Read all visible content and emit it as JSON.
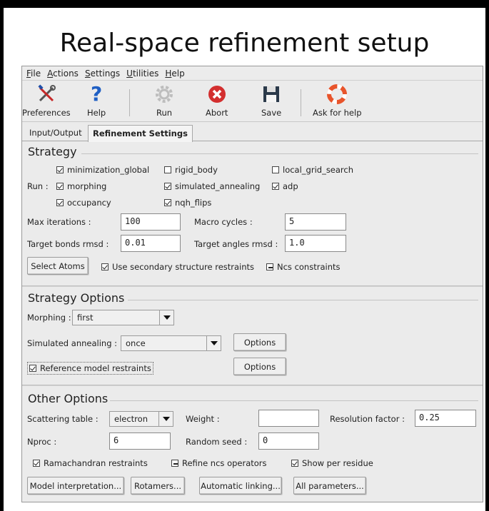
{
  "slide_title": "Real-space refinement setup",
  "menu": [
    {
      "first": "F",
      "rest": "ile"
    },
    {
      "first": "A",
      "rest": "ctions"
    },
    {
      "first": "S",
      "rest": "ettings"
    },
    {
      "first": "U",
      "rest": "tilities"
    },
    {
      "first": "H",
      "rest": "elp"
    }
  ],
  "toolbar": {
    "preferences": "Preferences",
    "help": "Help",
    "run": "Run",
    "abort": "Abort",
    "save": "Save",
    "ask_for_help": "Ask for help"
  },
  "tabs": {
    "input_output": "Input/Output",
    "refinement_settings": "Refinement Settings"
  },
  "strategy": {
    "title": "Strategy",
    "run_label": "Run :",
    "checks": {
      "minimization_global": "minimization_global",
      "rigid_body": "rigid_body",
      "local_grid_search": "local_grid_search",
      "morphing": "morphing",
      "simulated_annealing": "simulated_annealing",
      "adp": "adp",
      "occupancy": "occupancy",
      "nqh_flips": "nqh_flips"
    },
    "max_iterations_label": "Max iterations :",
    "max_iterations": "100",
    "macro_cycles_label": "Macro cycles :",
    "macro_cycles": "5",
    "target_bonds_label": "Target bonds rmsd :",
    "target_bonds": "0.01",
    "target_angles_label": "Target angles rmsd :",
    "target_angles": "1.0",
    "select_atoms": "Select Atoms",
    "secondary_structure": "Use secondary structure restraints",
    "ncs_constraints": "Ncs constraints"
  },
  "strategy_options": {
    "title": "Strategy Options",
    "morphing_label": "Morphing :",
    "morphing_value": "first",
    "sa_label": "Simulated annealing :",
    "sa_value": "once",
    "options_1": "Options",
    "reference_model": "Reference model restraints",
    "options_2": "Options"
  },
  "other_options": {
    "title": "Other Options",
    "scattering_label": "Scattering table :",
    "scattering_value": "electron",
    "weight_label": "Weight :",
    "weight_value": "",
    "resolution_label": "Resolution factor :",
    "resolution_value": "0.25",
    "nproc_label": "Nproc :",
    "nproc_value": "6",
    "seed_label": "Random seed :",
    "seed_value": "0",
    "ramachandran": "Ramachandran restraints",
    "refine_ncs": "Refine ncs operators",
    "show_per_residue": "Show per residue",
    "model_interpretation": "Model interpretation...",
    "rotamers": "Rotamers...",
    "automatic_linking": "Automatic linking...",
    "all_parameters": "All parameters..."
  },
  "icon_colors": {
    "help": "#1f5fc4",
    "abort": "#d32f2f",
    "save": "#2b3a4a",
    "lifebuoy": "#e8542b",
    "run": "#bdbdbd"
  }
}
